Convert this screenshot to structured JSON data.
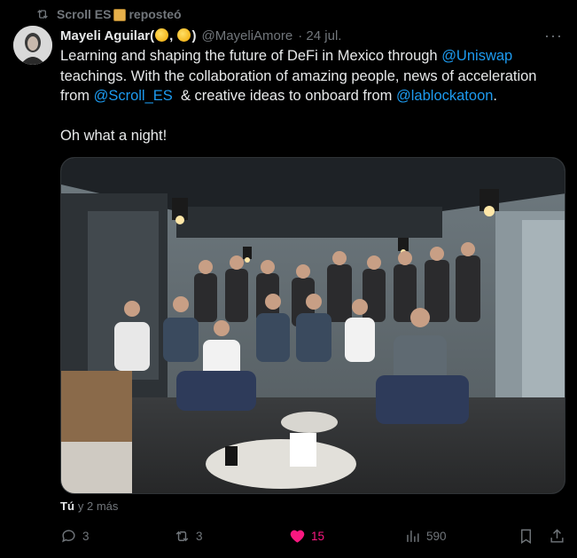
{
  "repost": {
    "actor": "Scroll ES",
    "label": "reposteó"
  },
  "tweet": {
    "author_name": "Mayeli Aguilar(",
    "author_name_close": ")",
    "handle": "@MayeliAmore",
    "date": "· 24 jul.",
    "line1_pre": "Learning and shaping the future of DeFi in Mexico through ",
    "mention_uniswap": "@Uniswap",
    "line2": "teachings. With the collaboration of amazing people, news of acceleration",
    "line3_pre": "from ",
    "mention_scroll": "@Scroll_ES",
    "line3_mid": "  & creative ideas to onboard from ",
    "mention_lablock": "@lablockatoon",
    "line3_end": ".",
    "closing": "Oh what a night!"
  },
  "tagged": {
    "first": "Tú",
    "rest": "y 2 más"
  },
  "actions": {
    "replies": "3",
    "reposts": "3",
    "likes": "15",
    "views": "590"
  },
  "colors": {
    "accent": "#1d9bf0",
    "like": "#f91880",
    "muted": "#71767b",
    "text": "#e7e9ea"
  }
}
